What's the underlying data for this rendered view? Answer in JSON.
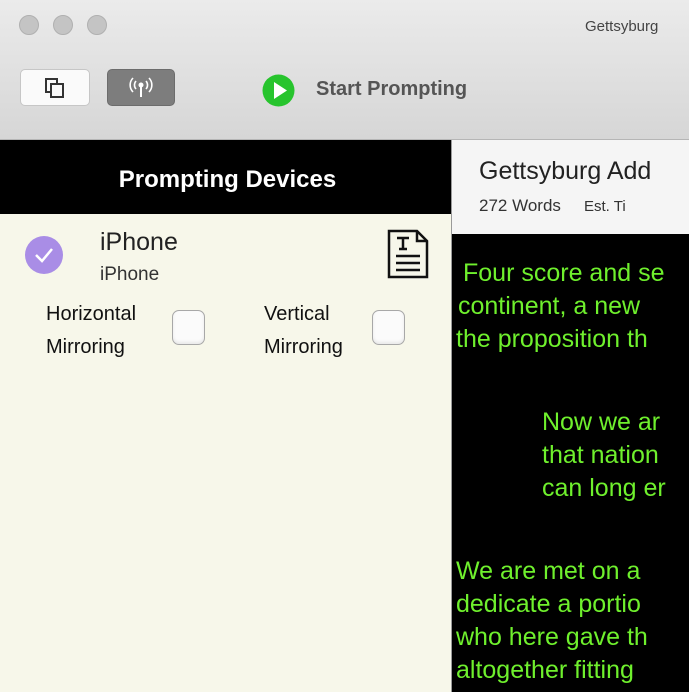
{
  "window": {
    "title": "Gettsyburg"
  },
  "toolbar": {
    "start_label": "Start Prompting"
  },
  "devices_panel": {
    "header": "Prompting Devices",
    "device": {
      "name": "iPhone",
      "model": "iPhone",
      "horizontal_label_1": "Horizontal",
      "horizontal_label_2": "Mirroring",
      "vertical_label_1": "Vertical",
      "vertical_label_2": "Mirroring"
    }
  },
  "script_panel": {
    "title": "Gettsyburg Add",
    "words": "272 Words",
    "est_time": "Est. Ti",
    "lines": [
      "Four score and se",
      "continent, a new",
      "the proposition th",
      "Now we ar",
      "that nation",
      "can long er",
      "We are met on a",
      "dedicate a portio",
      "who here gave th",
      "altogether fitting"
    ]
  },
  "colors": {
    "script_text": "#6ff02d",
    "panel_bg": "#f7f7ea",
    "check_accent": "#a98de6",
    "play_green": "#27c42d"
  },
  "icons": [
    "copy-icon",
    "broadcast-icon",
    "play-icon",
    "checkmark-icon",
    "document-text-icon"
  ]
}
